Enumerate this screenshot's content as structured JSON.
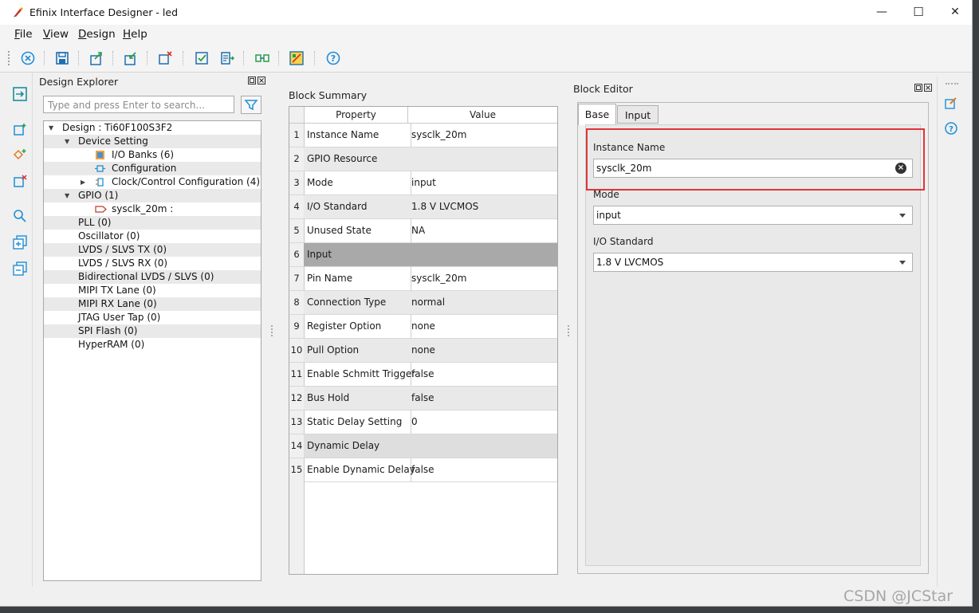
{
  "window": {
    "title": "Efinix Interface Designer - led",
    "minimize": "—",
    "maximize": "☐",
    "close": "✕"
  },
  "menu": [
    {
      "label": "File",
      "mnemonic": "F",
      "rest": "ile"
    },
    {
      "label": "View",
      "mnemonic": "V",
      "rest": "iew"
    },
    {
      "label": "Design",
      "mnemonic": "D",
      "rest": "esign"
    },
    {
      "label": "Help",
      "mnemonic": "H",
      "rest": "elp"
    }
  ],
  "toolbar_icons": [
    "close-design-icon",
    "save-icon",
    "export-icon",
    "import-icon",
    "delete-block-icon",
    "check-design-icon",
    "generate-icon",
    "link-icon",
    "resource-view-icon",
    "help-icon"
  ],
  "explorer": {
    "title": "Design Explorer",
    "search_placeholder": "Type and press Enter to search...",
    "tree": [
      {
        "label": "Design : Ti60F100S3F2"
      },
      {
        "label": "Device Setting"
      },
      {
        "label": "I/O Banks (6)"
      },
      {
        "label": "Configuration"
      },
      {
        "label": "Clock/Control Configuration (4)"
      },
      {
        "label": "GPIO (1)"
      },
      {
        "label": "sysclk_20m :"
      },
      {
        "label": "PLL (0)"
      },
      {
        "label": "Oscillator (0)"
      },
      {
        "label": "LVDS / SLVS TX (0)"
      },
      {
        "label": "LVDS / SLVS RX (0)"
      },
      {
        "label": "Bidirectional LVDS / SLVS (0)"
      },
      {
        "label": "MIPI TX Lane (0)"
      },
      {
        "label": "MIPI RX Lane (0)"
      },
      {
        "label": "JTAG User Tap (0)"
      },
      {
        "label": "SPI Flash (0)"
      },
      {
        "label": "HyperRAM (0)"
      }
    ]
  },
  "summary": {
    "title": "Block Summary",
    "col_property": "Property",
    "col_value": "Value",
    "rows": [
      {
        "n": "1",
        "property": "Instance Name",
        "value": "sysclk_20m"
      },
      {
        "n": "2",
        "property": "GPIO Resource",
        "value": ""
      },
      {
        "n": "3",
        "property": "Mode",
        "value": "input"
      },
      {
        "n": "4",
        "property": "I/O Standard",
        "value": "1.8 V LVCMOS"
      },
      {
        "n": "5",
        "property": "Unused State",
        "value": "NA"
      },
      {
        "n": "6",
        "property": "Input",
        "value": ""
      },
      {
        "n": "7",
        "property": "Pin Name",
        "value": "sysclk_20m"
      },
      {
        "n": "8",
        "property": "Connection Type",
        "value": "normal"
      },
      {
        "n": "9",
        "property": "Register Option",
        "value": "none"
      },
      {
        "n": "10",
        "property": "Pull Option",
        "value": "none"
      },
      {
        "n": "11",
        "property": "Enable Schmitt Trigger",
        "value": "false"
      },
      {
        "n": "12",
        "property": "Bus Hold",
        "value": "false"
      },
      {
        "n": "13",
        "property": "Static Delay Setting",
        "value": "0"
      },
      {
        "n": "14",
        "property": "Dynamic Delay",
        "value": ""
      },
      {
        "n": "15",
        "property": "Enable Dynamic Delay",
        "value": "false"
      }
    ]
  },
  "editor": {
    "title": "Block Editor",
    "tabs": [
      "Base",
      "Input"
    ],
    "active_tab": "Base",
    "instance_name_label": "Instance Name",
    "instance_name_value": "sysclk_20m",
    "mode_label": "Mode",
    "mode_value": "input",
    "io_standard_label": "I/O Standard",
    "io_standard_value": "1.8 V LVCMOS"
  },
  "watermark": "CSDN @JCStar",
  "colors": {
    "highlight": "#e0343a",
    "section_row": "#a9a9a9",
    "accent": "#1f8fd6"
  }
}
